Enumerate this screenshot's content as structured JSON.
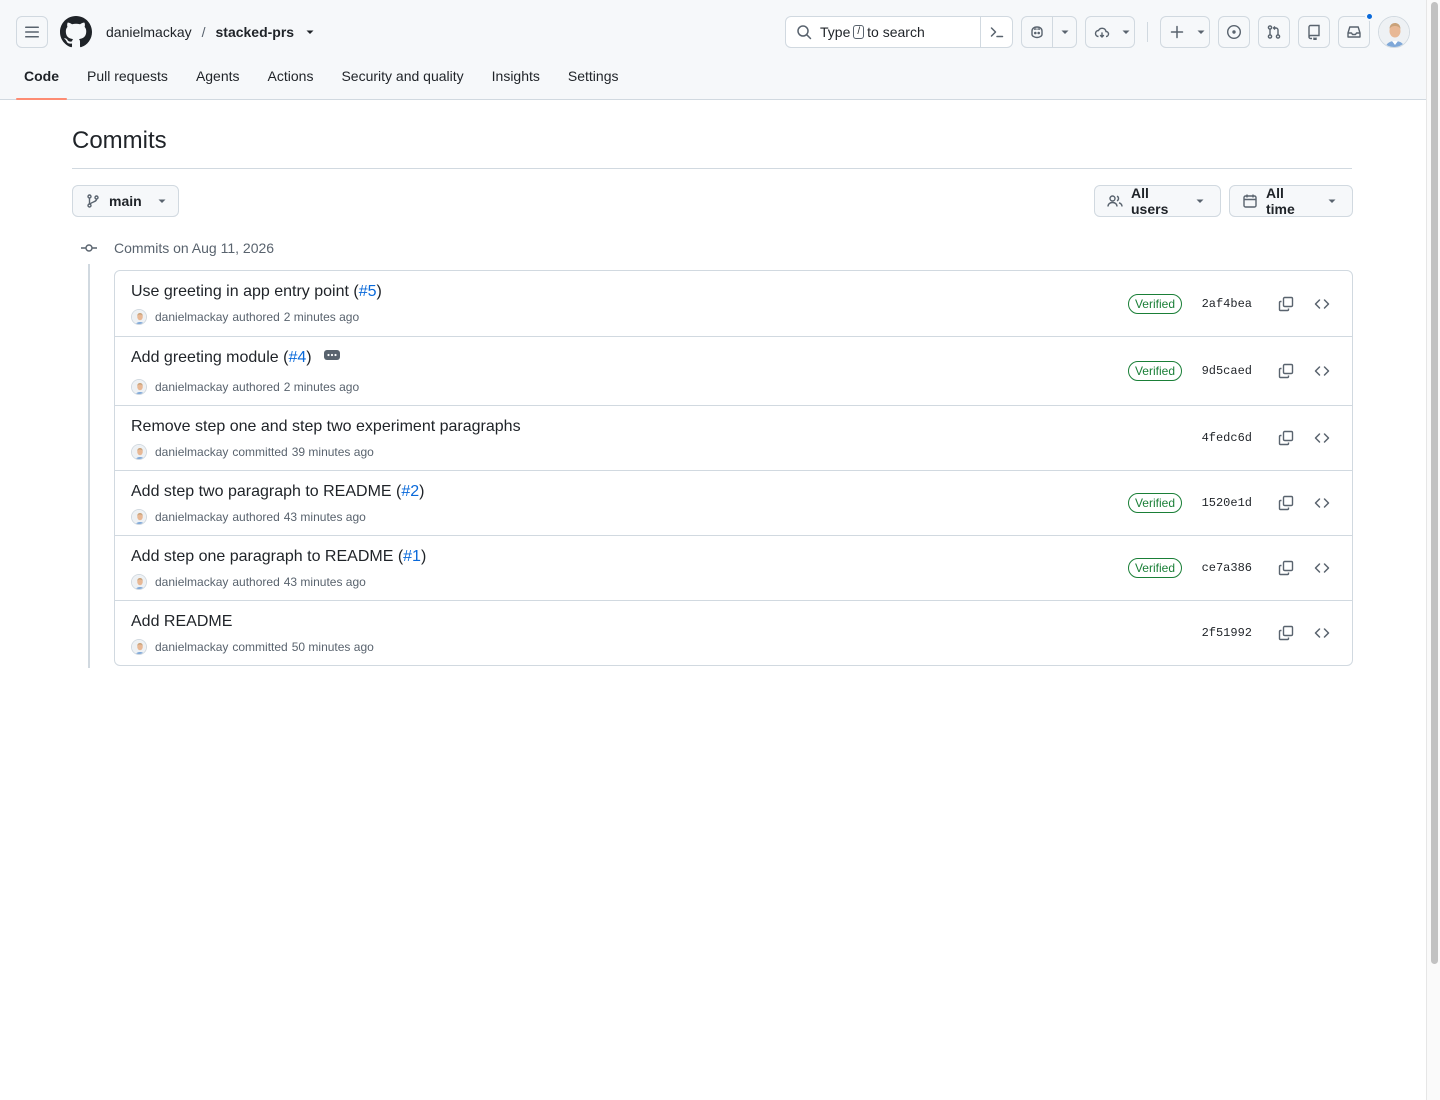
{
  "header": {
    "owner": "danielmackay",
    "separator": "/",
    "repo": "stacked-prs",
    "search": {
      "prefix": "Type",
      "key": "/",
      "suffix": "to search"
    }
  },
  "nav": {
    "items": [
      "Code",
      "Pull requests",
      "Agents",
      "Actions",
      "Security and quality",
      "Insights",
      "Settings"
    ],
    "active": "Code"
  },
  "page": {
    "title": "Commits",
    "branch": "main",
    "users_filter": "All users",
    "time_filter": "All time",
    "date_heading": "Commits on Aug 11, 2026"
  },
  "commits": [
    {
      "title": "Use greeting in app entry point (",
      "pr": "#5",
      "close": ")",
      "author": "danielmackay",
      "verb": "authored",
      "time": "2 minutes ago",
      "verified": "Verified",
      "sha": "2af4bea"
    },
    {
      "title": "Add greeting module (",
      "pr": "#4",
      "close": ")",
      "author": "danielmackay",
      "verb": "authored",
      "time": "2 minutes ago",
      "verified": "Verified",
      "sha": "9d5caed"
    },
    {
      "title": "Remove step one and step two experiment paragraphs",
      "pr": "",
      "close": "",
      "author": "danielmackay",
      "verb": "committed",
      "time": "39 minutes ago",
      "verified": "",
      "sha": "4fedc6d"
    },
    {
      "title": "Add step two paragraph to README (",
      "pr": "#2",
      "close": ")",
      "author": "danielmackay",
      "verb": "authored",
      "time": "43 minutes ago",
      "verified": "Verified",
      "sha": "1520e1d"
    },
    {
      "title": "Add step one paragraph to README (",
      "pr": "#1",
      "close": ")",
      "author": "danielmackay",
      "verb": "authored",
      "time": "43 minutes ago",
      "verified": "Verified",
      "sha": "ce7a386"
    },
    {
      "title": "Add README",
      "pr": "",
      "close": "",
      "author": "danielmackay",
      "verb": "committed",
      "time": "50 minutes ago",
      "verified": "",
      "sha": "2f51992"
    }
  ],
  "icons": {
    "menu": "hamburger-icon",
    "logo": "github-logo-icon",
    "search": "search-icon",
    "command": "command-palette-icon",
    "copilot": "copilot-icon",
    "codespaces": "cloud-icon",
    "create": "plus-icon",
    "issues": "issue-opened-icon",
    "pulls": "git-pull-request-icon",
    "repos": "repo-icon",
    "inbox": "inbox-icon",
    "branch": "git-branch-icon",
    "people": "people-icon",
    "calendar": "calendar-icon",
    "commit": "git-commit-icon",
    "copy": "copy-icon",
    "browse": "code-icon"
  },
  "colors": {
    "accent": "#0969da",
    "verified": "#1a7f37",
    "nav_underline": "#fd8c73",
    "notification": "#0969da"
  }
}
